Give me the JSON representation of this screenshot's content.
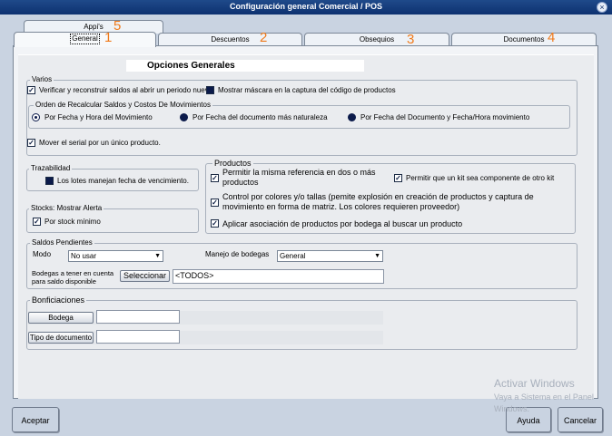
{
  "window": {
    "title": "Configuración general Comercial / POS",
    "close_icon": "×"
  },
  "tabs": [
    {
      "label": "General",
      "number": "1"
    },
    {
      "label": "Descuentos",
      "number": "2"
    },
    {
      "label": "Obsequios",
      "number": "3"
    },
    {
      "label": "Documentos",
      "number": "4"
    },
    {
      "label": "Appi's",
      "number": "5"
    }
  ],
  "heading": "Opciones Generales",
  "varios": {
    "legend": "Varios",
    "check1": "Verificar y reconstruir saldos al abrir un periodo nuevo.",
    "check2": "Mostrar máscara en la captura del código de productos",
    "orden": {
      "legend": "Orden de Recalcular Saldos y Costos De Movimientos",
      "radio1": "Por Fecha y Hora del Movimiento",
      "radio2": "Por Fecha del documento más naturaleza",
      "radio3": "Por Fecha del Documento y Fecha/Hora movimiento"
    },
    "check3": "Mover el serial por un único producto."
  },
  "trazabilidad": {
    "legend": "Trazabilidad",
    "check": "Los lotes manejan fecha de vencimiento."
  },
  "stocks": {
    "legend": "Stocks: Mostrar Alerta",
    "check": "Por stock mínimo"
  },
  "productos": {
    "legend": "Productos",
    "check1": "Permitir la misma referencia en dos o más productos",
    "check2": "Permitir que un kit sea componente de otro kit",
    "check3": "Control por colores y/o tallas (pemite explosión en creación de productos y captura de movimiento en forma de matriz. Los colores requieren proveedor)",
    "check4": "Aplicar asociación de productos por bodega al buscar un producto"
  },
  "saldos": {
    "legend": "Saldos Pendientes",
    "modo_label": "Modo",
    "modo_value": "No usar",
    "manejo_label": "Manejo de bodegas",
    "manejo_value": "General",
    "bodegas_label": "Bodegas a tener en cuenta para saldo disponible",
    "select_button": "Seleccionar",
    "bodegas_value": "<TODOS>"
  },
  "bonificaciones": {
    "legend": "Bonficiaciones",
    "bodega_button": "Bodega",
    "tipo_button": "Tipo de documento"
  },
  "footer": {
    "accept": "Aceptar",
    "help": "Ayuda",
    "cancel": "Cancelar"
  },
  "watermark": {
    "line1": "Activar Windows",
    "line2": "Vaya a Sistema en el Panel",
    "line3": "Windows."
  },
  "colors": {
    "title_bar": "#1f4a8a",
    "annotation": "#f07a1a",
    "window_bg": "#c9d3e1"
  }
}
